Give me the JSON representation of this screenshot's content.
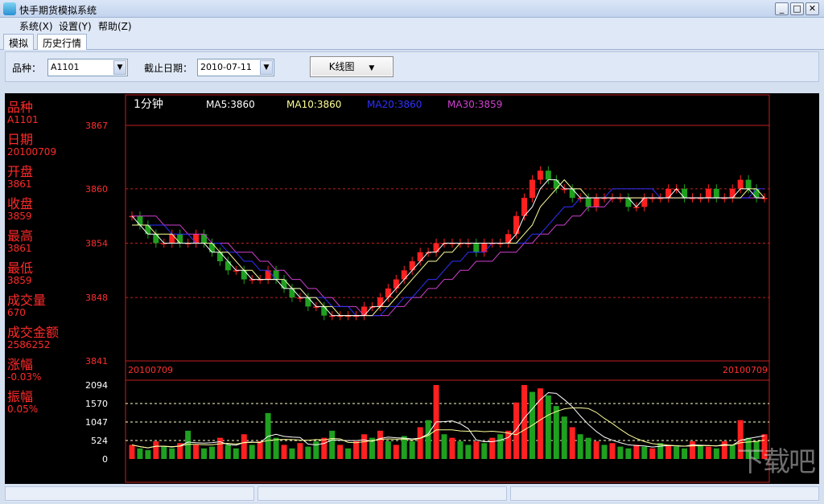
{
  "window": {
    "title": "快手期货模拟系统",
    "min": "_",
    "max": "□",
    "close": "✕"
  },
  "menu": [
    "系统(X)",
    "设置(Y)",
    "帮助(Z)"
  ],
  "tabs": [
    "模拟",
    "历史行情"
  ],
  "toolbar": {
    "variety_label": "品种：",
    "variety_value": "A1101",
    "date_label": "截止日期：",
    "date_value": "2010-07-11",
    "chart_button": "K线图"
  },
  "info": [
    {
      "label": "品种",
      "value": "A1101"
    },
    {
      "label": "日期",
      "value": "20100709"
    },
    {
      "label": "开盘",
      "value": "3861"
    },
    {
      "label": "收盘",
      "value": "3859"
    },
    {
      "label": "最高",
      "value": "3861"
    },
    {
      "label": "最低",
      "value": "3859"
    },
    {
      "label": "成交量",
      "value": "670"
    },
    {
      "label": "成交金额",
      "value": "2586252"
    },
    {
      "label": "涨幅",
      "value": "-0.03%"
    },
    {
      "label": "振幅",
      "value": "0.05%"
    }
  ],
  "colors": {
    "up": "#ff2020",
    "down": "#1fa01f",
    "ma5": "#ffffff",
    "ma10": "#ffff99",
    "ma20": "#3030ff",
    "ma30": "#d040d0",
    "grid": "#c02020"
  },
  "watermark": "下载吧",
  "chart_data": {
    "type": "line",
    "period_label": "1分钟",
    "ma_labels": [
      "MA5:3860",
      "MA10:3860",
      "MA20:3860",
      "MA30:3859"
    ],
    "price_ticks": [
      "3867",
      "3860",
      "3854",
      "3848",
      "3841"
    ],
    "volume_ticks": [
      "2094",
      "1570",
      "1047",
      "524",
      "0"
    ],
    "ylim": [
      3841,
      3867
    ],
    "date_left": "20100709",
    "date_right": "20100709",
    "close_series": [
      3857,
      3856,
      3855,
      3854,
      3854,
      3855,
      3854,
      3854,
      3855,
      3854,
      3853,
      3852,
      3851,
      3851,
      3850,
      3850,
      3850,
      3851,
      3850,
      3849,
      3848,
      3848,
      3847,
      3847,
      3846,
      3846,
      3846,
      3846,
      3846,
      3847,
      3847,
      3848,
      3849,
      3850,
      3851,
      3852,
      3853,
      3853,
      3854,
      3854,
      3854,
      3854,
      3854,
      3853,
      3854,
      3854,
      3854,
      3855,
      3857,
      3859,
      3861,
      3862,
      3861,
      3860,
      3860,
      3859,
      3859,
      3858,
      3859,
      3859,
      3859,
      3859,
      3858,
      3858,
      3859,
      3859,
      3859,
      3860,
      3860,
      3859,
      3859,
      3859,
      3860,
      3859,
      3859,
      3860,
      3861,
      3860,
      3859,
      3859
    ],
    "ma5": [
      3857,
      3856,
      3855,
      3855,
      3854,
      3854,
      3854,
      3854,
      3854,
      3854,
      3853,
      3853,
      3852,
      3851,
      3851,
      3850,
      3850,
      3850,
      3850,
      3849,
      3849,
      3848,
      3848,
      3847,
      3847,
      3846,
      3846,
      3846,
      3846,
      3846,
      3847,
      3847,
      3848,
      3849,
      3850,
      3851,
      3852,
      3853,
      3853,
      3854,
      3854,
      3854,
      3854,
      3854,
      3854,
      3854,
      3854,
      3854,
      3855,
      3857,
      3858,
      3860,
      3861,
      3861,
      3860,
      3860,
      3859,
      3859,
      3859,
      3859,
      3859,
      3859,
      3859,
      3858,
      3859,
      3859,
      3859,
      3859,
      3860,
      3859,
      3859,
      3859,
      3859,
      3859,
      3859,
      3859,
      3860,
      3860,
      3859,
      3859
    ],
    "ma10": [
      3856,
      3856,
      3856,
      3855,
      3855,
      3855,
      3854,
      3854,
      3854,
      3854,
      3854,
      3853,
      3853,
      3852,
      3851,
      3851,
      3850,
      3850,
      3850,
      3850,
      3849,
      3849,
      3848,
      3848,
      3847,
      3847,
      3846,
      3846,
      3846,
      3846,
      3846,
      3847,
      3847,
      3848,
      3849,
      3850,
      3851,
      3852,
      3852,
      3853,
      3853,
      3854,
      3854,
      3854,
      3854,
      3854,
      3854,
      3854,
      3854,
      3855,
      3856,
      3858,
      3859,
      3860,
      3861,
      3860,
      3860,
      3859,
      3859,
      3859,
      3859,
      3859,
      3859,
      3859,
      3859,
      3859,
      3859,
      3859,
      3859,
      3859,
      3859,
      3859,
      3859,
      3859,
      3859,
      3859,
      3859,
      3860,
      3860,
      3859
    ],
    "ma20": [
      3856,
      3856,
      3856,
      3856,
      3856,
      3855,
      3855,
      3855,
      3854,
      3854,
      3854,
      3854,
      3853,
      3853,
      3852,
      3852,
      3851,
      3851,
      3850,
      3850,
      3849,
      3849,
      3848,
      3848,
      3848,
      3847,
      3847,
      3847,
      3846,
      3846,
      3846,
      3846,
      3847,
      3847,
      3848,
      3848,
      3849,
      3850,
      3850,
      3851,
      3852,
      3852,
      3853,
      3853,
      3853,
      3854,
      3854,
      3854,
      3854,
      3854,
      3855,
      3855,
      3856,
      3857,
      3858,
      3858,
      3859,
      3859,
      3859,
      3859,
      3860,
      3860,
      3860,
      3860,
      3860,
      3860,
      3859,
      3859,
      3859,
      3859,
      3859,
      3859,
      3859,
      3859,
      3859,
      3859,
      3859,
      3859,
      3860,
      3860
    ],
    "ma30": [
      3857,
      3857,
      3857,
      3857,
      3856,
      3856,
      3856,
      3855,
      3855,
      3855,
      3854,
      3854,
      3854,
      3853,
      3853,
      3853,
      3852,
      3852,
      3851,
      3851,
      3850,
      3850,
      3849,
      3849,
      3848,
      3848,
      3847,
      3847,
      3847,
      3846,
      3846,
      3846,
      3846,
      3847,
      3847,
      3848,
      3848,
      3849,
      3849,
      3850,
      3850,
      3851,
      3851,
      3852,
      3852,
      3852,
      3853,
      3853,
      3853,
      3854,
      3854,
      3855,
      3855,
      3856,
      3856,
      3857,
      3857,
      3858,
      3858,
      3858,
      3859,
      3859,
      3859,
      3859,
      3859,
      3859,
      3859,
      3859,
      3859,
      3859,
      3859,
      3859,
      3859,
      3859,
      3859,
      3859,
      3859,
      3859,
      3859,
      3859
    ],
    "volume": [
      400,
      300,
      250,
      500,
      350,
      300,
      450,
      800,
      400,
      300,
      350,
      600,
      400,
      300,
      700,
      400,
      500,
      1300,
      600,
      400,
      300,
      450,
      350,
      500,
      600,
      800,
      400,
      300,
      500,
      700,
      600,
      800,
      500,
      400,
      650,
      500,
      900,
      1100,
      2094,
      700,
      600,
      500,
      400,
      500,
      450,
      600,
      700,
      800,
      1600,
      2094,
      1900,
      2000,
      1800,
      1500,
      1200,
      900,
      700,
      600,
      500,
      400,
      450,
      350,
      300,
      400,
      350,
      300,
      450,
      400,
      350,
      300,
      500,
      400,
      350,
      300,
      500,
      400,
      1100,
      600,
      500,
      700
    ],
    "volume_up": [
      true,
      false,
      false,
      true,
      false,
      false,
      true,
      false,
      true,
      false,
      false,
      true,
      false,
      false,
      true,
      false,
      true,
      false,
      false,
      true,
      false,
      true,
      false,
      false,
      true,
      false,
      true,
      false,
      true,
      true,
      false,
      true,
      false,
      true,
      false,
      false,
      true,
      false,
      true,
      false,
      true,
      false,
      false,
      true,
      false,
      true,
      false,
      true,
      true,
      true,
      false,
      true,
      false,
      false,
      false,
      true,
      false,
      false,
      true,
      false,
      true,
      false,
      false,
      true,
      false,
      true,
      false,
      true,
      false,
      false,
      true,
      false,
      true,
      false,
      true,
      false,
      true,
      false,
      false,
      true
    ]
  }
}
